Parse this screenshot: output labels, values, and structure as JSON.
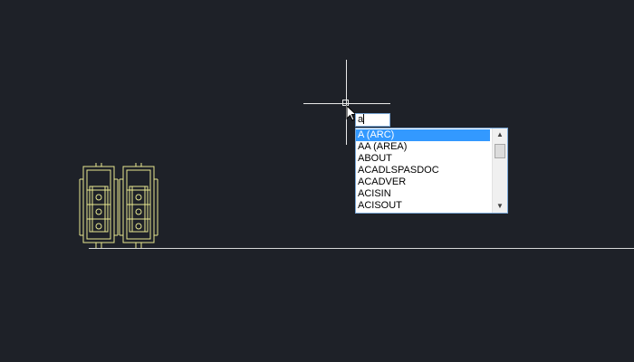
{
  "colors": {
    "background": "#1e2128",
    "geometry": "#e8e890",
    "crosshair": "#e8e8e8",
    "selection": "#3399ff"
  },
  "command_input": {
    "value": "a"
  },
  "autocomplete": {
    "items": [
      {
        "label": "A (ARC)",
        "selected": true
      },
      {
        "label": "AA (AREA)",
        "selected": false
      },
      {
        "label": "ABOUT",
        "selected": false
      },
      {
        "label": "ACADLSPASDOC",
        "selected": false
      },
      {
        "label": "ACADVER",
        "selected": false
      },
      {
        "label": "ACISIN",
        "selected": false
      },
      {
        "label": "ACISOUT",
        "selected": false
      }
    ],
    "scroll_up_icon": "triangle-up-icon",
    "scroll_down_icon": "triangle-down-icon"
  }
}
